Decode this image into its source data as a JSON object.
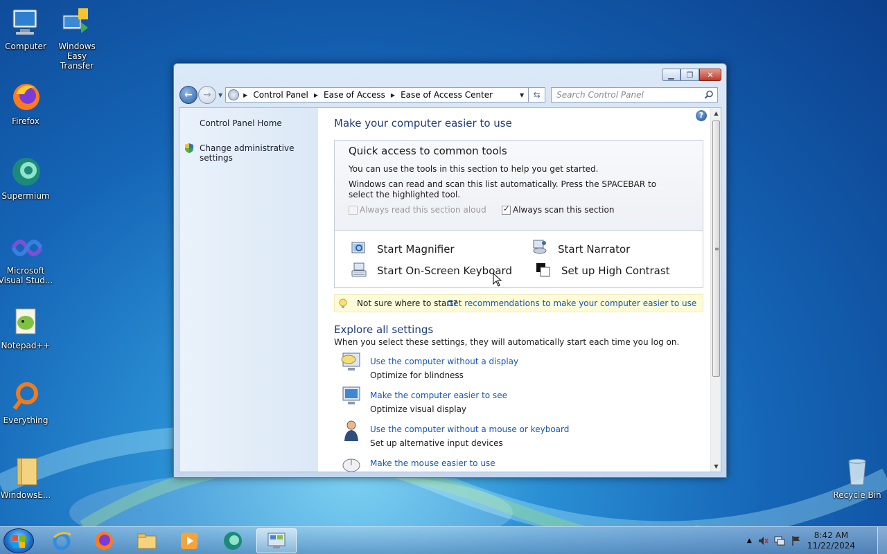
{
  "desktop": {
    "icons": [
      {
        "label": "Computer",
        "icon": "computer-icon"
      },
      {
        "label": "Windows Easy Transfer",
        "icon": "easy-transfer-icon"
      },
      {
        "label": "Firefox",
        "icon": "firefox-icon"
      },
      {
        "label": "Supermium",
        "icon": "supermium-icon"
      },
      {
        "label": "Microsoft Visual Stud...",
        "icon": "visual-studio-icon"
      },
      {
        "label": "Notepad++",
        "icon": "notepad-plus-plus-icon"
      },
      {
        "label": "Everything",
        "icon": "everything-icon"
      },
      {
        "label": "WindowsE...",
        "icon": "folder-icon"
      },
      {
        "label": "Recycle Bin",
        "icon": "recycle-bin-icon"
      }
    ]
  },
  "window": {
    "caption": {
      "minimize": "▁",
      "maximize": "❐",
      "close": "✕"
    },
    "address": {
      "crumbs": [
        "Control Panel",
        "Ease of Access",
        "Ease of Access Center"
      ]
    },
    "search": {
      "placeholder": "Search Control Panel"
    },
    "left_pane": {
      "home_link": "Control Panel Home",
      "admin_link": "Change administrative settings"
    },
    "main": {
      "title": "Make your computer easier to use",
      "quick_access": {
        "heading": "Quick access to common tools",
        "intro": "You can use the tools in this section to help you get started.",
        "scan_info": "Windows can read and scan this list automatically.  Press the SPACEBAR to select the highlighted tool.",
        "read_aloud": {
          "label": "Always read this section aloud",
          "checked": false,
          "enabled": false
        },
        "scan_section": {
          "label": "Always scan this section",
          "checked": true,
          "enabled": true
        },
        "tools": [
          {
            "label": "Start Magnifier",
            "icon": "magnifier-icon"
          },
          {
            "label": "Start Narrator",
            "icon": "narrator-icon"
          },
          {
            "label": "Start On-Screen Keyboard",
            "icon": "keyboard-icon"
          },
          {
            "label": "Set up High Contrast",
            "icon": "high-contrast-icon"
          }
        ]
      },
      "tip": {
        "question": "Not sure where to start?",
        "link": "Get recommendations to make your computer easier to use"
      },
      "explore": {
        "heading": "Explore all settings",
        "subtitle": "When you select these settings, they will automatically start each time you log on.",
        "settings": [
          {
            "link": "Use the computer without a display",
            "desc": "Optimize for blindness",
            "icon": "blindness-display-icon"
          },
          {
            "link": "Make the computer easier to see",
            "desc": "Optimize visual display",
            "icon": "visual-display-icon"
          },
          {
            "link": "Use the computer without a mouse or keyboard",
            "desc": "Set up alternative input devices",
            "icon": "person-input-icon"
          },
          {
            "link": "Make the mouse easier to use",
            "desc": "",
            "icon": "mouse-icon"
          }
        ]
      }
    }
  },
  "taskbar": {
    "items": [
      "internet-explorer-icon",
      "firefox-icon",
      "file-explorer-icon",
      "media-player-icon",
      "supermium-icon",
      "control-panel-icon"
    ],
    "clock": {
      "time": "8:42 AM",
      "date": "11/22/2024"
    }
  },
  "colors": {
    "link": "#1656b3",
    "heading": "#1e3c78",
    "tip_bg": "#fdfbd8"
  }
}
